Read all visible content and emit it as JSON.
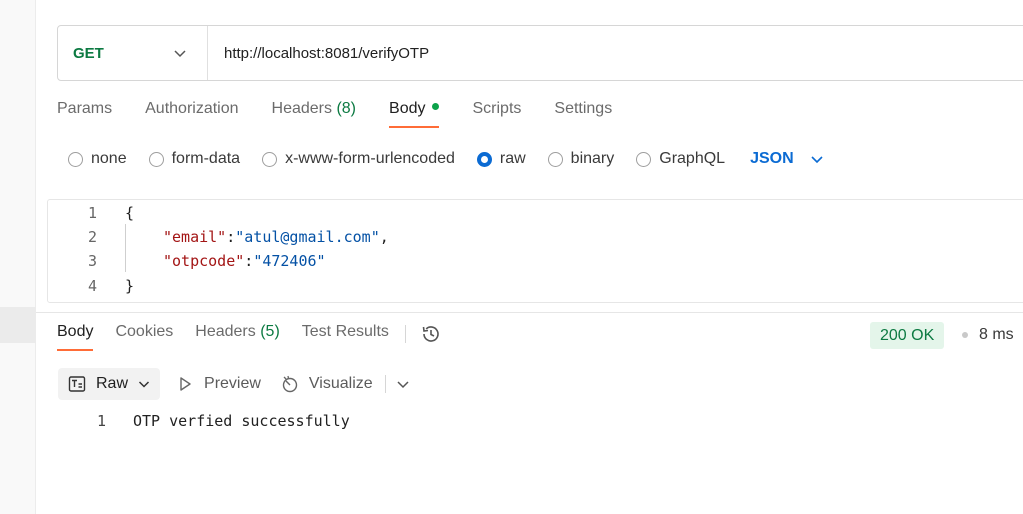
{
  "request": {
    "method": "GET",
    "url": "http://localhost:8081/verifyOTP"
  },
  "request_tabs": [
    {
      "label": "Params"
    },
    {
      "label": "Authorization"
    },
    {
      "label": "Headers",
      "count": "(8)"
    },
    {
      "label": "Body",
      "active": true
    },
    {
      "label": "Scripts"
    },
    {
      "label": "Settings"
    }
  ],
  "body_types": {
    "none": "none",
    "form_data": "form-data",
    "urlencoded": "x-www-form-urlencoded",
    "raw": "raw",
    "binary": "binary",
    "graphql": "GraphQL",
    "selected": "raw",
    "format": "JSON"
  },
  "editor": {
    "line_numbers": [
      "1",
      "2",
      "3",
      "4"
    ],
    "open_brace": "{",
    "email_key": "\"email\"",
    "email_value": "\"atul@gmail.com\"",
    "otp_key": "\"otpcode\"",
    "otp_value": "\"472406\"",
    "close_brace": "}"
  },
  "response_tabs": {
    "body": "Body",
    "cookies": "Cookies",
    "headers": "Headers",
    "headers_count": "(5)",
    "test_results": "Test Results"
  },
  "status": {
    "code": "200 OK",
    "time": "8 ms",
    "color": "#0c7a42"
  },
  "response_toolbar": {
    "raw": "Raw",
    "preview": "Preview",
    "visualize": "Visualize"
  },
  "response_body": {
    "line_number": "1",
    "text": "OTP verfied successfully"
  },
  "colors": {
    "accent": "#ff6c37",
    "link": "#0b6bd3",
    "method_get": "#0c7a42"
  }
}
